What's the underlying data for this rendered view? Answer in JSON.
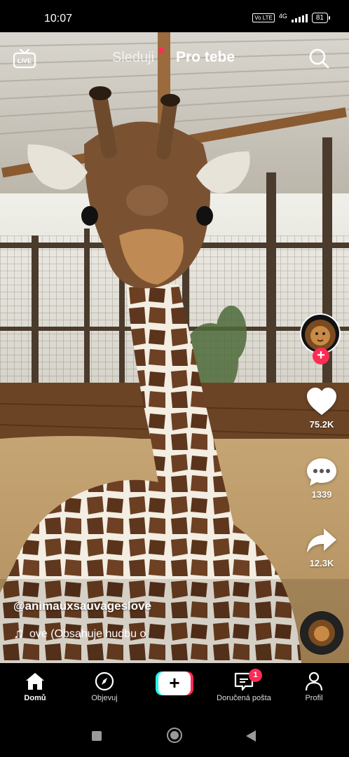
{
  "status_bar": {
    "time": "10:07",
    "volte": "Vo LTE",
    "network": "4G",
    "battery": "81"
  },
  "top_nav": {
    "live_label": "LIVE",
    "tab_following": "Sleduji",
    "tab_for_you": "Pro tebe",
    "icons": [
      "live-icon",
      "search-icon"
    ]
  },
  "post": {
    "username": "@animauxsauvageslove",
    "music": "ove (Obsahuje hudbu o",
    "likes": "75.2K",
    "comments": "1339",
    "shares": "12.3K"
  },
  "bottom_nav": {
    "home": "Domů",
    "discover": "Objevuj",
    "create": "+",
    "inbox": "Doručená pošta",
    "inbox_badge": "1",
    "profile": "Profil"
  },
  "colors": {
    "accent": "#fe2c55",
    "cyan": "#25f4ee",
    "background": "#000000"
  }
}
